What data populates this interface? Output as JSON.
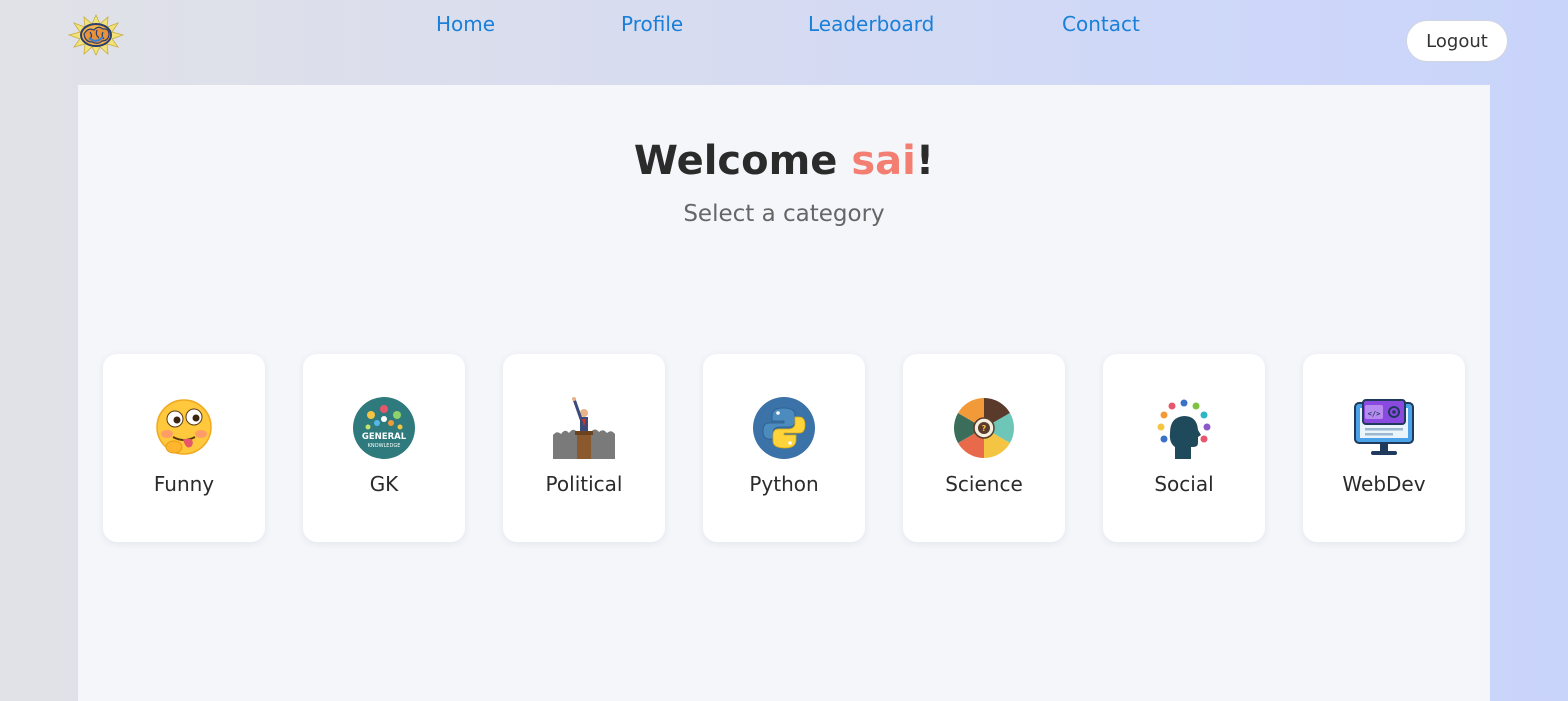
{
  "nav": {
    "home": "Home",
    "profile": "Profile",
    "leaderboard": "Leaderboard",
    "contact": "Contact",
    "logout": "Logout"
  },
  "welcome": {
    "prefix": "Welcome ",
    "username": "sai",
    "suffix": "!",
    "subtitle": "Select a category"
  },
  "categories": [
    {
      "label": "Funny",
      "icon": "winking-tongue-emoji-icon"
    },
    {
      "label": "GK",
      "icon": "general-knowledge-badge-icon"
    },
    {
      "label": "Political",
      "icon": "politician-podium-icon"
    },
    {
      "label": "Python",
      "icon": "python-logo-icon"
    },
    {
      "label": "Science",
      "icon": "science-wheel-icon"
    },
    {
      "label": "Social",
      "icon": "social-head-icon"
    },
    {
      "label": "WebDev",
      "icon": "webdev-monitor-icon"
    }
  ],
  "colors": {
    "nav_link": "#1a7fd8",
    "username_accent": "#f37f72",
    "title_text": "#2b2b2b",
    "main_panel": "#f4f6fa"
  }
}
